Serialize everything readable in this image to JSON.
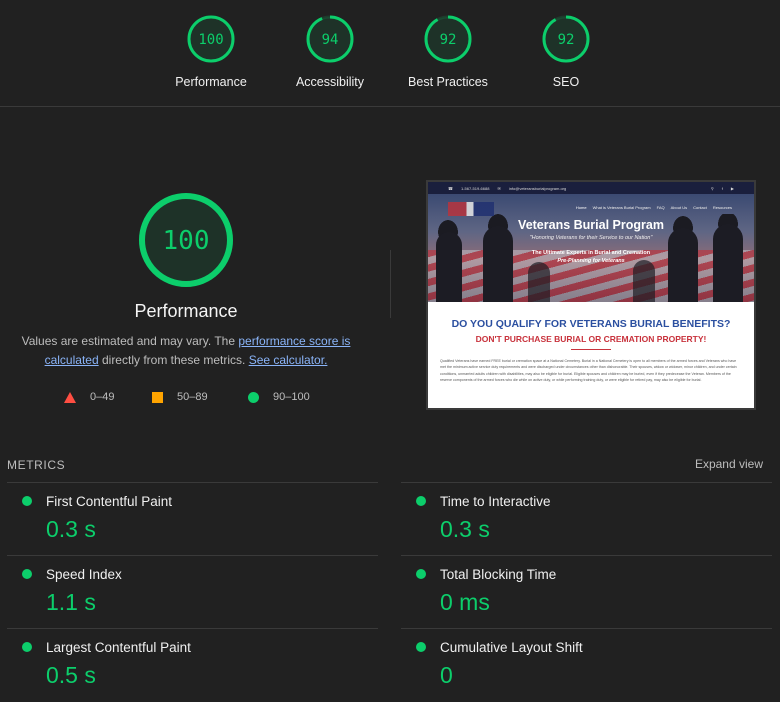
{
  "colors": {
    "pass": "#0cce6b",
    "average": "#ffa400",
    "fail": "#ff4e42",
    "background": "#212121"
  },
  "summary_gauges": [
    {
      "score": 100,
      "label": "Performance"
    },
    {
      "score": 94,
      "label": "Accessibility"
    },
    {
      "score": 92,
      "label": "Best Practices"
    },
    {
      "score": 92,
      "label": "SEO"
    }
  ],
  "performance": {
    "score": 100,
    "title": "Performance",
    "desc_prefix": "Values are estimated and may vary. The ",
    "score_link": "performance score is calculated",
    "desc_middle": " directly from these metrics. ",
    "calculator_link": "See calculator."
  },
  "legend": [
    {
      "icon": "triangle-fail-icon",
      "range": "0–49"
    },
    {
      "icon": "square-average-icon",
      "range": "50–89"
    },
    {
      "icon": "circle-pass-icon",
      "range": "90–100"
    }
  ],
  "screenshot": {
    "topbar_phone": "1-567-519-6688",
    "topbar_email": "info@veteransburialprogram.org",
    "nav": [
      "Home",
      "What is Veterans Burial Program",
      "FAQ",
      "About Us",
      "Contact",
      "Resources"
    ],
    "title": "Veterans Burial Program",
    "subtitle": "\"Honoring Veterans for their Service to our Nation\"",
    "tagline1": "The Ultimate Experts in Burial and Cremation",
    "tagline2": "Pre-Planning for Veterans",
    "q1": "DO YOU QUALIFY FOR VETERANS BURIAL BENEFITS?",
    "q2": "DON'T PURCHASE BURIAL OR CREMATION PROPERTY!",
    "para": "Qualified Veterans have earned FREE burial or cremation space at a National Cemetery. Burial in a National Cemetery is open to all members of the armed forces and Veterans who have met the minimum active service duty requirements and were discharged under circumstances other than dishonorable. Their spouses, widow or widower, minor children, and under certain conditions, unmarried adults children with disabilities, may also be eligible for burial. Eligible spouses and children may be buried, even if they predecease the Veteran. Members of the reserve components of the armed forces who die while on active duty, or while performing training duty, or were eligible for retired pay, may also be eligible for burial."
  },
  "metrics_header": "METRICS",
  "expand_label": "Expand view",
  "metrics": [
    {
      "name": "First Contentful Paint",
      "value": "0.3 s"
    },
    {
      "name": "Time to Interactive",
      "value": "0.3 s"
    },
    {
      "name": "Speed Index",
      "value": "1.1 s"
    },
    {
      "name": "Total Blocking Time",
      "value": "0 ms"
    },
    {
      "name": "Largest Contentful Paint",
      "value": "0.5 s"
    },
    {
      "name": "Cumulative Layout Shift",
      "value": "0"
    }
  ]
}
